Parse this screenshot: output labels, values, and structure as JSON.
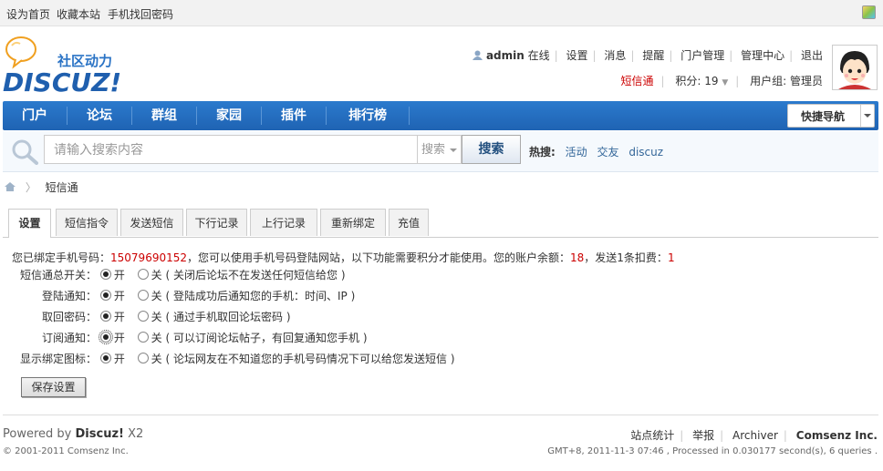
{
  "topbar": {
    "links": [
      "设为首页",
      "收藏本站",
      "手机找回密码"
    ]
  },
  "logo": {
    "tagline": "社区动力",
    "brand": "DISCUZ!"
  },
  "user": {
    "name": "admin",
    "status": "在线",
    "links": [
      "设置",
      "消息",
      "提醒",
      "门户管理",
      "管理中心",
      "退出"
    ],
    "sms_link": "短信通",
    "credits_label": "积分: 19",
    "group_label": "用户组: 管理员"
  },
  "nav": {
    "items": [
      "门户",
      "论坛",
      "群组",
      "家园",
      "插件",
      "排行榜"
    ],
    "quick_nav": "快捷导航"
  },
  "search": {
    "placeholder": "请输入搜索内容",
    "type": "搜索",
    "button": "搜索",
    "hot_label": "热搜:",
    "hot": [
      "活动",
      "交友",
      "discuz"
    ]
  },
  "breadcrumb": {
    "current": "短信通"
  },
  "tabs": [
    "设置",
    "短信指令",
    "发送短信",
    "下行记录",
    "上行记录",
    "重新绑定",
    "充值"
  ],
  "info": {
    "prefix": "您已绑定手机号码：",
    "phone": "15079690152",
    "middle": "，您可以使用手机号码登陆网站，以下功能需要积分才能使用。您的账户余额：",
    "balance": "18",
    "mid2": "，发送1条扣费：",
    "cost": "1"
  },
  "settings": [
    {
      "label": "短信通总开关：",
      "on": "开",
      "off": "关",
      "desc": "( 关闭后论坛不在发送任何短信给您 )"
    },
    {
      "label": "登陆通知：",
      "on": "开",
      "off": "关",
      "desc": "( 登陆成功后通知您的手机：时间、IP )"
    },
    {
      "label": "取回密码：",
      "on": "开",
      "off": "关",
      "desc": "( 通过手机取回论坛密码 )"
    },
    {
      "label": "订阅通知：",
      "on": "开",
      "off": "关",
      "desc": "( 可以订阅论坛帖子，有回复通知您手机 )"
    },
    {
      "label": "显示绑定图标：",
      "on": "开",
      "off": "关",
      "desc": "( 论坛网友在不知道您的手机号码情况下可以给您发送短信 )"
    }
  ],
  "save_button": "保存设置",
  "footer": {
    "powered_prefix": "Powered by",
    "powered_brand": "Discuz!",
    "version": "X2",
    "copyright": "© 2001-2011 Comsenz Inc.",
    "links": [
      "站点统计",
      "举报",
      "Archiver",
      "Comsenz Inc."
    ],
    "info": "GMT+8, 2011-11-3 07:46 , Processed in 0.030177 second(s), 6 queries ."
  },
  "colors": {
    "nav": "#2468b8",
    "accent_red": "#cc0000",
    "link_blue": "#336699"
  }
}
